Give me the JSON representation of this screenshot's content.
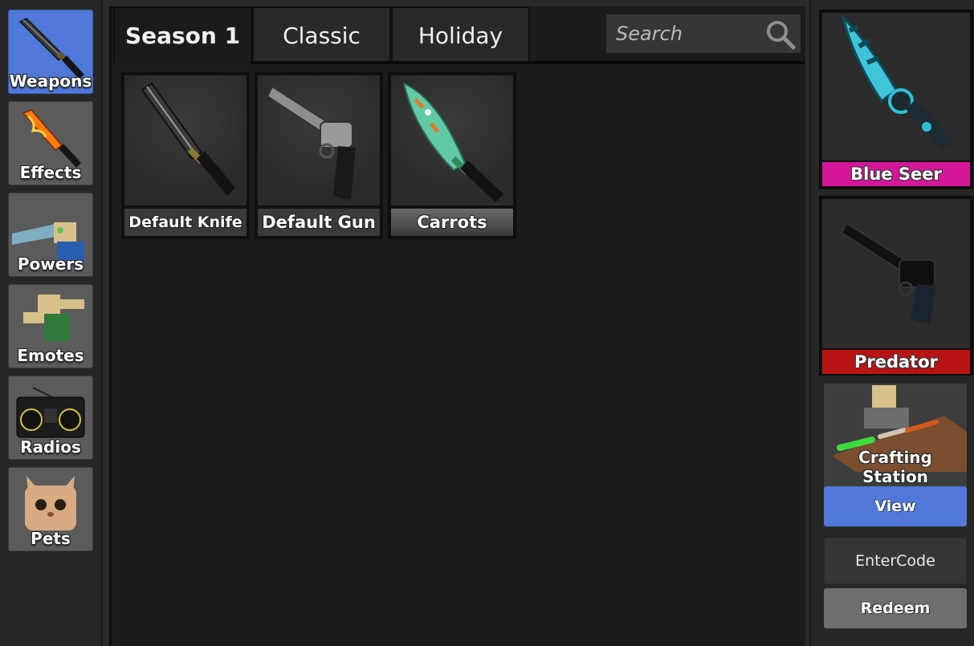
{
  "sidebar": {
    "items": [
      {
        "label": "Weapons",
        "icon": "knife-icon",
        "active": true
      },
      {
        "label": "Effects",
        "icon": "flame-knife-icon"
      },
      {
        "label": "Powers",
        "icon": "power-character-icon"
      },
      {
        "label": "Emotes",
        "icon": "emote-character-icon"
      },
      {
        "label": "Radios",
        "icon": "boombox-icon"
      },
      {
        "label": "Pets",
        "icon": "cat-pet-icon"
      }
    ]
  },
  "tabs": [
    {
      "label": "Season 1",
      "active": true
    },
    {
      "label": "Classic"
    },
    {
      "label": "Holiday"
    }
  ],
  "search": {
    "placeholder": "Search",
    "icon": "search-icon"
  },
  "items": [
    {
      "name": "Default Knife",
      "icon": "knife-icon"
    },
    {
      "name": "Default Gun",
      "icon": "revolver-icon"
    },
    {
      "name": "Carrots",
      "icon": "carrot-knife-icon"
    }
  ],
  "equipped": [
    {
      "name": "Blue Seer",
      "rarity_color": "#d4169b",
      "icon": "blue-seer-knife-icon"
    },
    {
      "name": "Predator",
      "rarity_color": "#b81414",
      "icon": "predator-gun-icon"
    }
  ],
  "crafting": {
    "label": "Crafting Station",
    "button": "View"
  },
  "code": {
    "placeholder": "EnterCode",
    "button": "Redeem"
  },
  "colors": {
    "accent_blue": "#4f78d8",
    "legend_pink": "#d4169b",
    "godly_red": "#b81414"
  }
}
